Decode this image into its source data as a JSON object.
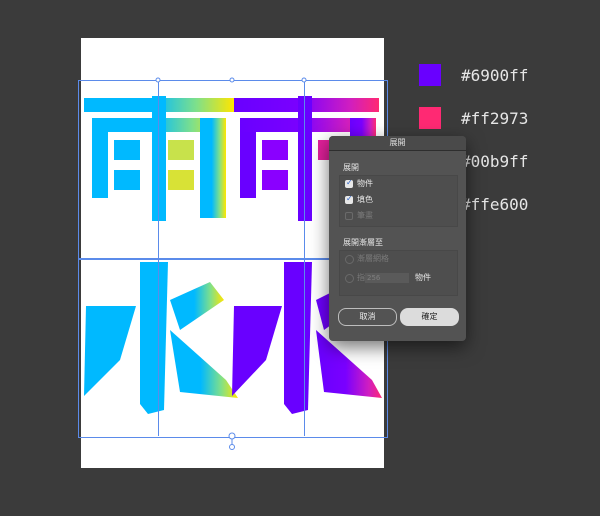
{
  "swatches": [
    {
      "hex": "#6900ff",
      "label": "#6900ff"
    },
    {
      "hex": "#ff2973",
      "label": "#ff2973"
    },
    {
      "hex": "#00b9ff",
      "label": "#00b9ff"
    },
    {
      "hex": "#ffe600",
      "label": "#ffe600"
    }
  ],
  "artwork": {
    "characters": [
      "雨",
      "雨",
      "水",
      "水"
    ]
  },
  "dialog": {
    "title": "展開",
    "expand_group": {
      "title": "展開",
      "options": [
        {
          "label": "物件",
          "checked": true,
          "enabled": true
        },
        {
          "label": "填色",
          "checked": true,
          "enabled": true
        },
        {
          "label": "筆畫",
          "checked": false,
          "enabled": false
        }
      ]
    },
    "gradient_group": {
      "title": "展開漸層至",
      "mesh_label": "漸層網格",
      "specify_label": "指定:",
      "specify_value": "256",
      "specify_unit": "物件"
    },
    "cancel_label": "取消",
    "ok_label": "確定"
  }
}
